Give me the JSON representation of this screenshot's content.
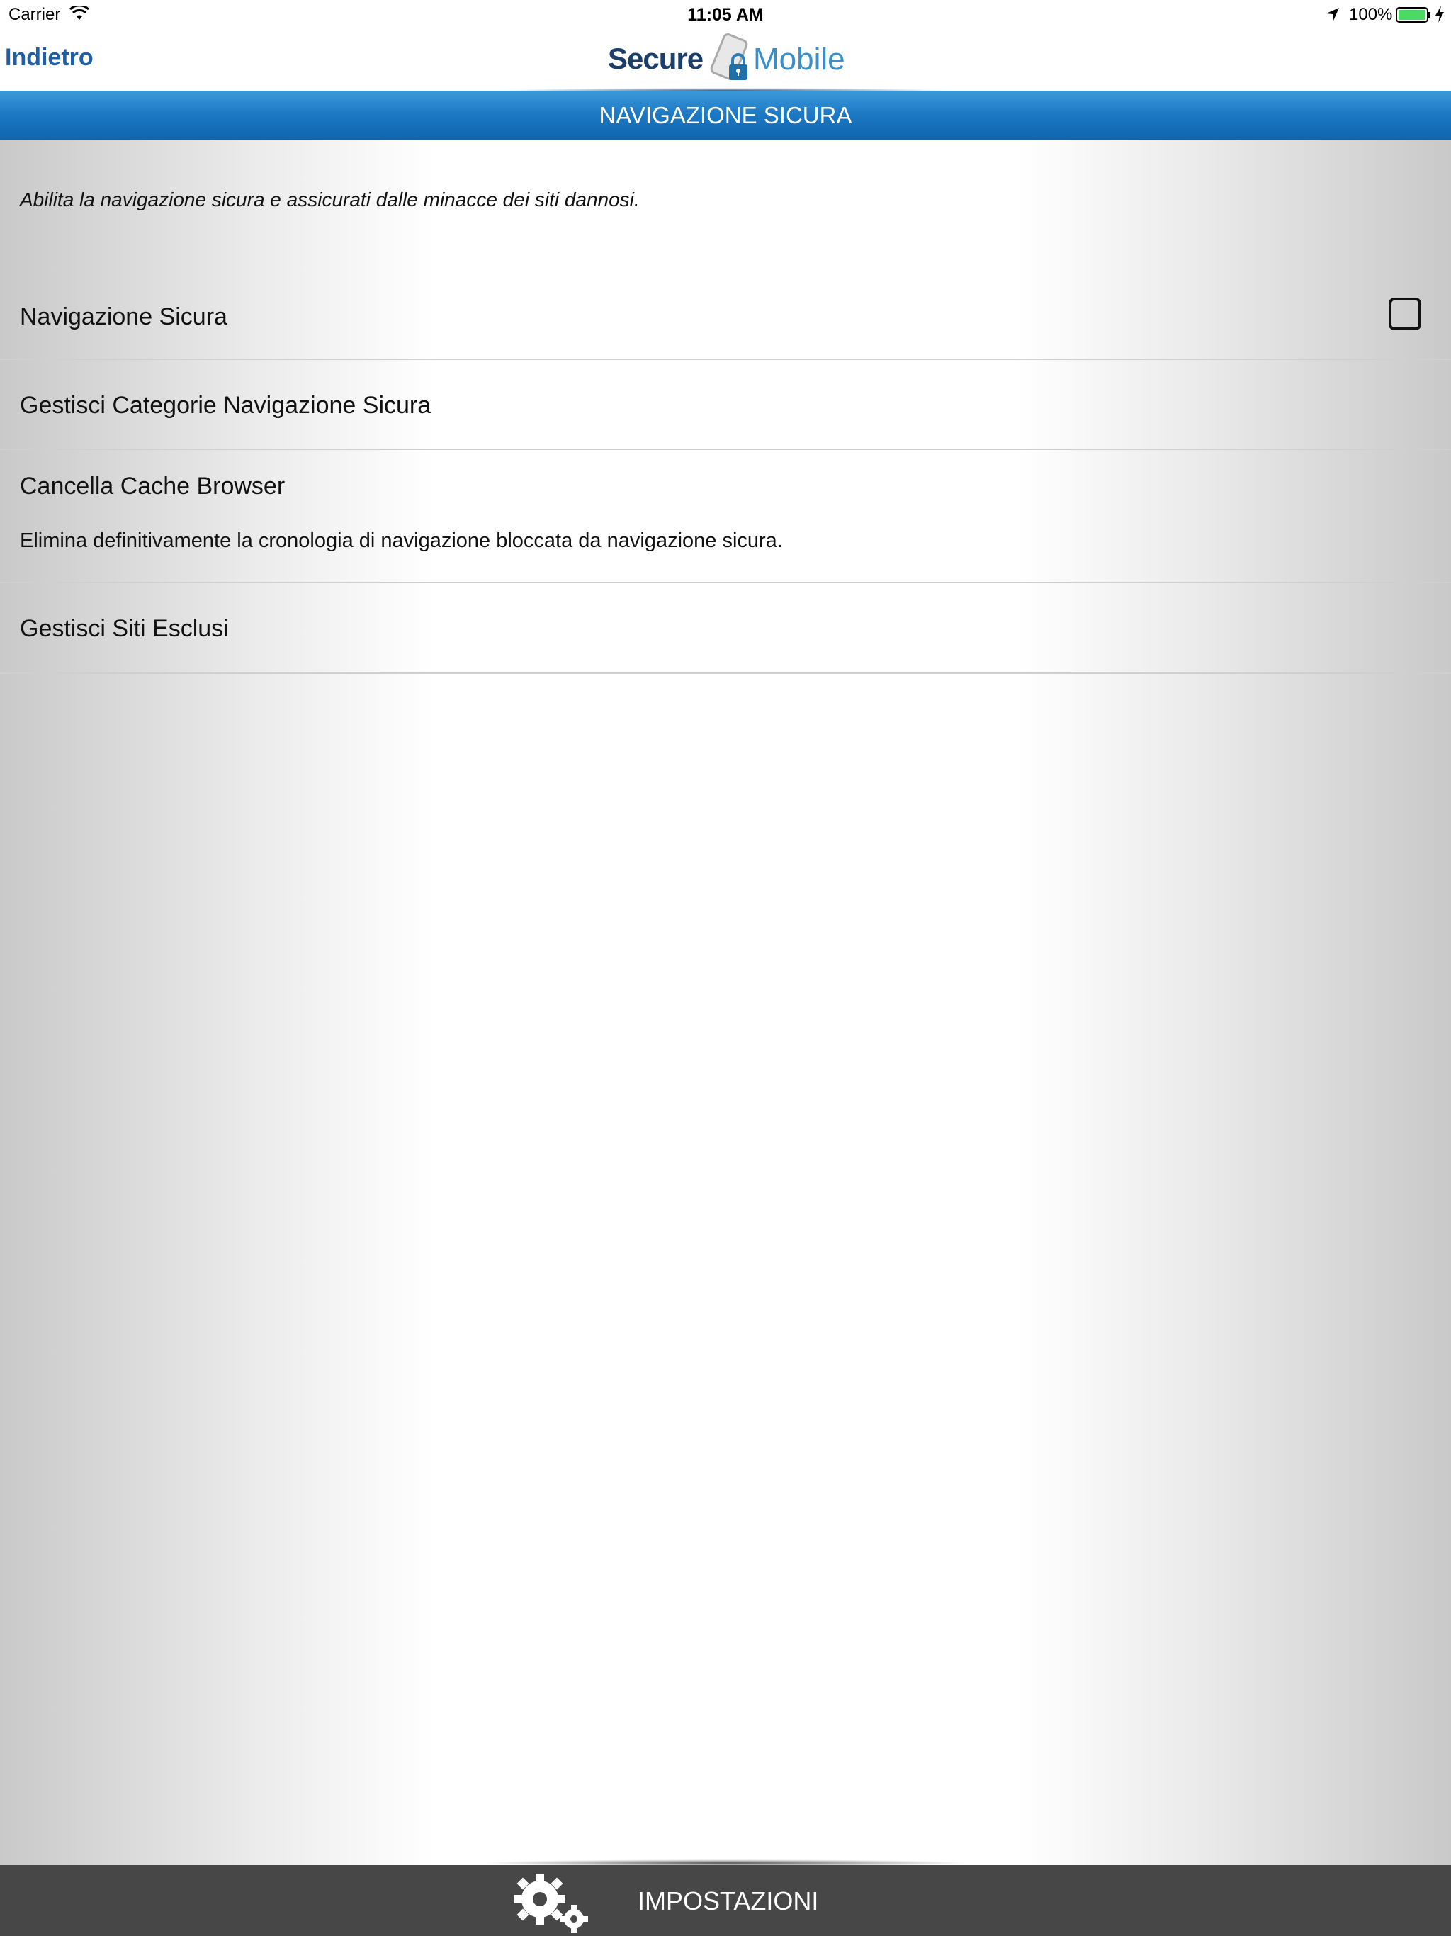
{
  "status_bar": {
    "carrier": "Carrier",
    "time": "11:05 AM",
    "battery": "100%"
  },
  "nav": {
    "back_label": "Indietro",
    "logo_left": "Secure",
    "logo_right": "Mobile"
  },
  "banner": {
    "title": "NAVIGAZIONE SICURA"
  },
  "content": {
    "intro": "Abilita la navigazione sicura e assicurati dalle minacce dei siti dannosi.",
    "rows": [
      {
        "label": "Navigazione Sicura",
        "checked": false
      },
      {
        "label": "Gestisci Categorie Navigazione Sicura"
      },
      {
        "label": "Cancella Cache Browser",
        "sub": "Elimina definitivamente la cronologia di navigazione bloccata da navigazione sicura."
      },
      {
        "label": "Gestisci Siti Esclusi"
      }
    ]
  },
  "tab_bar": {
    "label": "IMPOSTAZIONI"
  },
  "colors": {
    "banner": "#1c77c2",
    "back_link": "#1f5fa8",
    "tab_bar": "#474747",
    "battery": "#4cd964"
  }
}
